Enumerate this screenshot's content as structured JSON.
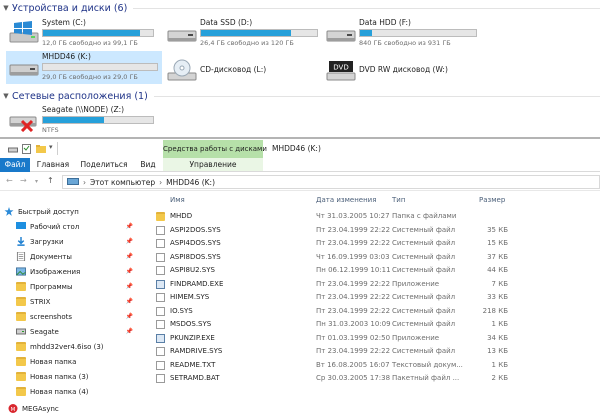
{
  "devices_section": {
    "title": "Устройства и диски (6)"
  },
  "network_section": {
    "title": "Сетевые расположения (1)"
  },
  "drives": [
    {
      "name": "System (C:)",
      "info": "12,0 ГБ свободно из 99,1 ГБ",
      "used": 0.88
    },
    {
      "name": "Data SSD (D:)",
      "info": "26,4 ГБ свободно из 120 ГБ",
      "used": 0.78
    },
    {
      "name": "Data HDD (F:)",
      "info": "840 ГБ свободно из 931 ГБ",
      "used": 0.1
    },
    {
      "name": "MHDD46 (K:)",
      "info": "29,0 ГБ свободно из 29,0 ГБ",
      "used": 0.0
    },
    {
      "name": "CD-дисковод (L:)",
      "info": ""
    },
    {
      "name": "DVD RW дисковод (W:)",
      "info": ""
    }
  ],
  "network_drive": {
    "name": "Seagate (\\\\NODE) (Z:)",
    "info": "NTFS",
    "used": 0.55
  },
  "titlebar": {
    "context_group": "Средства работы с дисками",
    "title": "MHDD46 (K:)"
  },
  "ribbon": {
    "file": "Файл",
    "home": "Главная",
    "share": "Поделиться",
    "view": "Вид",
    "manage": "Управление"
  },
  "address": {
    "pc": "Этот компьютер",
    "sep1": "›",
    "sep2": "›",
    "drive": "MHDD46 (K:)"
  },
  "nav": {
    "items": [
      {
        "label": "Быстрый доступ",
        "pin": false,
        "kind": "star"
      },
      {
        "label": "Рабочий стол",
        "pin": true,
        "kind": "desktop"
      },
      {
        "label": "Загрузки",
        "pin": true,
        "kind": "download"
      },
      {
        "label": "Документы",
        "pin": true,
        "kind": "docs"
      },
      {
        "label": "Изображения",
        "pin": true,
        "kind": "images"
      },
      {
        "label": "Программы",
        "pin": true,
        "kind": "folder"
      },
      {
        "label": "STRIX",
        "pin": true,
        "kind": "folder"
      },
      {
        "label": "screenshots",
        "pin": true,
        "kind": "folder"
      },
      {
        "label": "Seagate",
        "pin": true,
        "kind": "drive"
      },
      {
        "label": "mhdd32ver4.6iso (3)",
        "pin": false,
        "kind": "folder"
      },
      {
        "label": "Новая папка",
        "pin": false,
        "kind": "folder"
      },
      {
        "label": "Новая папка (3)",
        "pin": false,
        "kind": "folder"
      },
      {
        "label": "Новая папка (4)",
        "pin": false,
        "kind": "folder"
      },
      {
        "label": "MEGAsync",
        "pin": false,
        "kind": "mega"
      }
    ]
  },
  "columns": {
    "name": "Имя",
    "date": "Дата изменения",
    "type": "Тип",
    "size": "Размер"
  },
  "files": [
    {
      "name": "MHDD",
      "date": "Чт 31.03.2005 10:27",
      "type": "Папка с файлами",
      "size": "",
      "kind": "folder"
    },
    {
      "name": "ASPI2DOS.SYS",
      "date": "Пт 23.04.1999 22:22",
      "type": "Системный файл",
      "size": "35 КБ",
      "kind": "file"
    },
    {
      "name": "ASPI4DOS.SYS",
      "date": "Пт 23.04.1999 22:22",
      "type": "Системный файл",
      "size": "15 КБ",
      "kind": "file"
    },
    {
      "name": "ASPI8DOS.SYS",
      "date": "Чт 16.09.1999 03:03",
      "type": "Системный файл",
      "size": "37 КБ",
      "kind": "file"
    },
    {
      "name": "ASPI8U2.SYS",
      "date": "Пн 06.12.1999 10:11",
      "type": "Системный файл",
      "size": "44 КБ",
      "kind": "file"
    },
    {
      "name": "FINDRAMD.EXE",
      "date": "Пт 23.04.1999 22:22",
      "type": "Приложение",
      "size": "7 КБ",
      "kind": "exe"
    },
    {
      "name": "HIMEM.SYS",
      "date": "Пт 23.04.1999 22:22",
      "type": "Системный файл",
      "size": "33 КБ",
      "kind": "file"
    },
    {
      "name": "IO.SYS",
      "date": "Пт 23.04.1999 22:22",
      "type": "Системный файл",
      "size": "218 КБ",
      "kind": "file"
    },
    {
      "name": "MSDOS.SYS",
      "date": "Пн 31.03.2003 10:09",
      "type": "Системный файл",
      "size": "1 КБ",
      "kind": "file"
    },
    {
      "name": "PKUNZIP.EXE",
      "date": "Пт 01.03.1999 02:50",
      "type": "Приложение",
      "size": "34 КБ",
      "kind": "exe"
    },
    {
      "name": "RAMDRIVE.SYS",
      "date": "Пт 23.04.1999 22:22",
      "type": "Системный файл",
      "size": "13 КБ",
      "kind": "file"
    },
    {
      "name": "README.TXT",
      "date": "Вт 16.08.2005 16:07",
      "type": "Текстовый докум...",
      "size": "1 КБ",
      "kind": "txt"
    },
    {
      "name": "SETRAMD.BAT",
      "date": "Ср 30.03.2005 17:38",
      "type": "Пакетный файл ...",
      "size": "2 КБ",
      "kind": "txt"
    }
  ],
  "colors": {
    "accent": "#1979ca",
    "bar_fill": "#26a0da",
    "selection": "#cce8ff",
    "context": "#b6e0a9"
  }
}
